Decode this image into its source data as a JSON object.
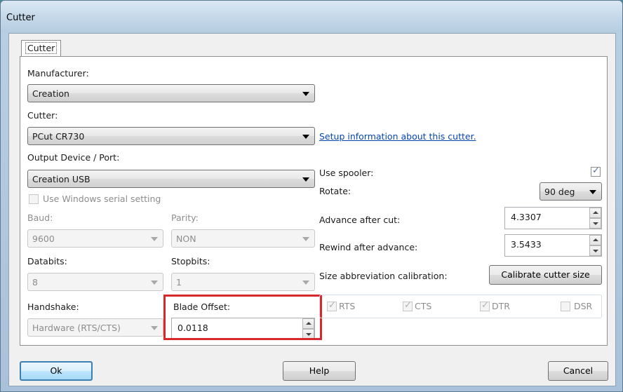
{
  "window": {
    "title": "Cutter"
  },
  "tab": {
    "label": "Cutter"
  },
  "left": {
    "manufacturer_label": "Manufacturer:",
    "manufacturer_value": "Creation",
    "cutter_label": "Cutter:",
    "cutter_value": "PCut CR730",
    "output_label": "Output Device / Port:",
    "output_value": "Creation USB",
    "use_windows_serial_label": "Use Windows serial setting",
    "use_windows_serial_checked": false,
    "baud_label": "Baud:",
    "baud_value": "9600",
    "parity_label": "Parity:",
    "parity_value": "NON",
    "databits_label": "Databits:",
    "databits_value": "8",
    "stopbits_label": "Stopbits:",
    "stopbits_value": "1",
    "handshake_label": "Handshake:",
    "handshake_value": "Hardware (RTS/CTS)",
    "blade_offset_label": "Blade Offset:",
    "blade_offset_value": "0.0118"
  },
  "right": {
    "setup_link": "Setup information about this cutter.",
    "use_spooler_label": "Use spooler:",
    "use_spooler_checked": true,
    "rotate_label": "Rotate:",
    "rotate_value": "90 deg",
    "advance_label": "Advance after cut:",
    "advance_value": "4.3307",
    "rewind_label": "Rewind after advance:",
    "rewind_value": "3.5433",
    "size_calib_label": "Size abbreviation calibration:",
    "calibrate_button": "Calibrate cutter size",
    "signals": [
      {
        "label": "RTS",
        "checked": true
      },
      {
        "label": "CTS",
        "checked": true
      },
      {
        "label": "DTR",
        "checked": true
      },
      {
        "label": "DSR",
        "checked": false
      }
    ]
  },
  "footer": {
    "ok": "Ok",
    "help": "Help",
    "cancel": "Cancel"
  },
  "colors": {
    "highlight": "#d7282d",
    "link": "#0645ad",
    "checkbox_tick": "#5b6fa3"
  }
}
